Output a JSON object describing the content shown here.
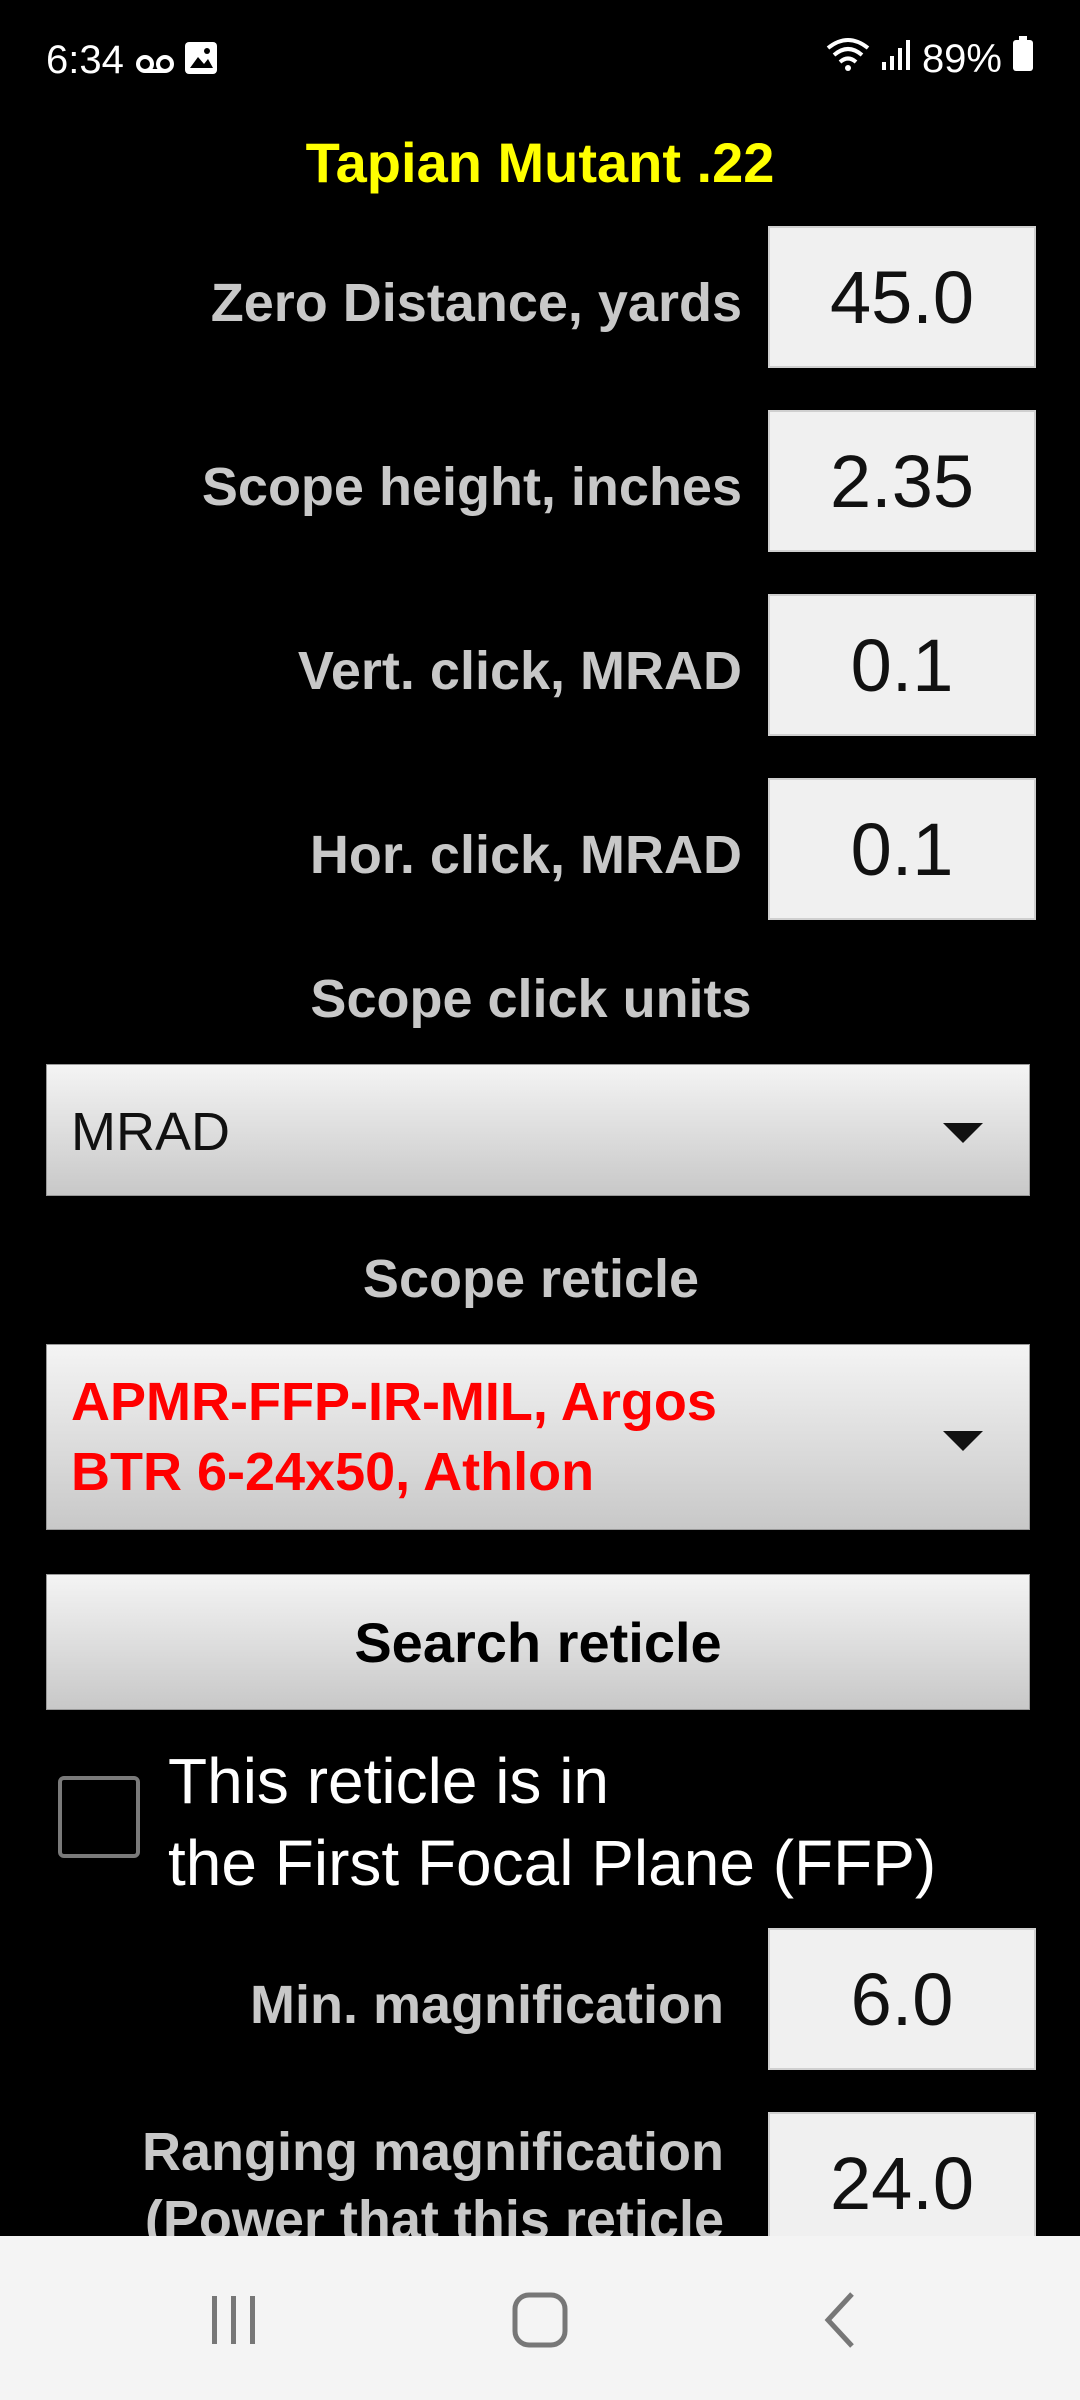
{
  "status_bar": {
    "time": "6:34",
    "battery": "89%",
    "icons": [
      "voicemail-icon",
      "image-icon",
      "wifi-icon",
      "signal-icon",
      "battery-icon"
    ]
  },
  "app_title": "Tapian Mutant .22",
  "fields": {
    "zero_distance": {
      "label": "Zero Distance, yards",
      "value": "45.0"
    },
    "scope_height": {
      "label": "Scope height, inches",
      "value": "2.35"
    },
    "vert_click": {
      "label": "Vert. click, MRAD",
      "value": "0.1"
    },
    "hor_click": {
      "label": "Hor. click, MRAD",
      "value": "0.1"
    },
    "min_magnification": {
      "label": "Min. magnification",
      "value": "6.0"
    },
    "ranging_magnification": {
      "label_line1": "Ranging magnification",
      "label_line2": "(Power that this reticle",
      "value": "24.0"
    }
  },
  "scope_click_units": {
    "heading": "Scope click units",
    "selected": "MRAD"
  },
  "scope_reticle": {
    "heading": "Scope reticle",
    "selected_line1": "APMR-FFP-IR-MIL, Argos",
    "selected_line2": "BTR 6-24x50, Athlon"
  },
  "search_button_label": "Search reticle",
  "ffp_checkbox": {
    "checked": false,
    "label_line1": "This reticle is in",
    "label_line2": "the First Focal Plane (FFP)"
  },
  "colors": {
    "title": "#ffff00",
    "reticle_text": "#ff0000",
    "label_text": "#c8c8c8",
    "background": "#000000"
  }
}
